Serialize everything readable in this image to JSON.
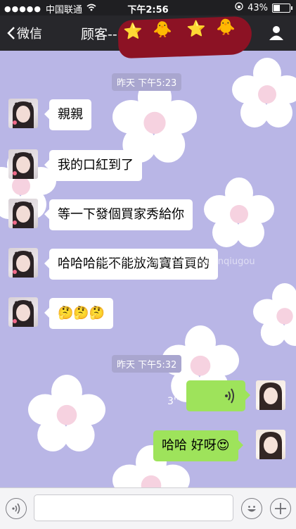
{
  "status_bar": {
    "carrier": "中国联通",
    "time": "下午2:56",
    "battery": "43%",
    "battery_level": 0.43
  },
  "nav": {
    "back_label": "微信",
    "title": "顾客--"
  },
  "chat": {
    "timestamps": [
      "昨天 下午5:23",
      "昨天 下午5:32"
    ],
    "incoming": [
      {
        "text": "親親"
      },
      {
        "text": "我的口紅到了"
      },
      {
        "text": "等一下發個買家秀給你"
      },
      {
        "text": "哈哈哈能不能放淘寶首頁的"
      },
      {
        "text": "🤔🤔🤔"
      }
    ],
    "outgoing": [
      {
        "voice_duration": "3''"
      },
      {
        "text": "哈哈 好呀😍"
      }
    ],
    "watermark": "weibo.com/xiaoxianhuquanqiugou"
  },
  "input_bar": {
    "voice_icon": "voice-icon",
    "emoji_icon": "emoji-icon",
    "add_icon": "add-icon"
  }
}
